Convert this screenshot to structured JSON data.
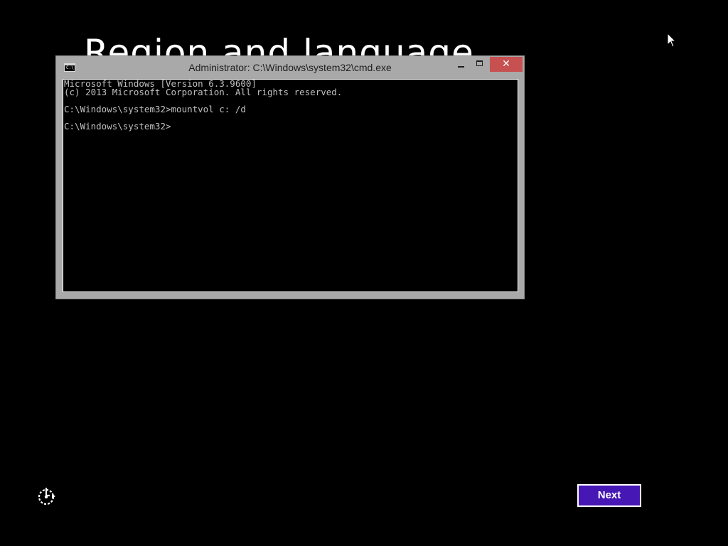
{
  "background": {
    "title": "Region and language",
    "color": "#000000"
  },
  "cmd_window": {
    "title": "Administrator: C:\\Windows\\system32\\cmd.exe",
    "icon": "cmd-icon",
    "icon_glyph": "C:\\",
    "buttons": {
      "minimize": "minimize-icon",
      "maximize": "maximize-icon",
      "close": "close-icon",
      "close_glyph": "✕"
    },
    "close_color": "#c75050",
    "frame_color": "#a9a9a9",
    "console_lines": [
      "Microsoft Windows [Version 6.3.9600]",
      "(c) 2013 Microsoft Corporation. All rights reserved.",
      "",
      "C:\\Windows\\system32>mountvol c: /d",
      "",
      "C:\\Windows\\system32>"
    ]
  },
  "setup": {
    "icon": "ease-of-access-icon"
  },
  "next_button": {
    "label": "Next",
    "color": "#4617b4"
  },
  "cursor": {
    "icon": "mouse-pointer-icon"
  }
}
